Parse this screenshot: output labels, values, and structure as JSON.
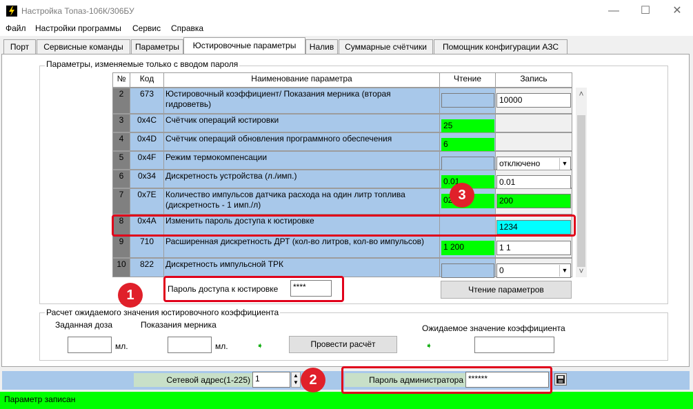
{
  "window": {
    "title": "Настройка Топаз-106К/306БУ",
    "minimize": "—",
    "maximize": "☐",
    "close": "✕"
  },
  "menu": [
    "Файл",
    "Настройки программы",
    "Сервис",
    "Справка"
  ],
  "tabs": [
    "Порт",
    "Сервисные команды",
    "Параметры",
    "Юстировочные параметры",
    "Налив",
    "Суммарные счётчики",
    "Помощник конфигурации АЗС"
  ],
  "active_tab": "Юстировочные параметры",
  "params_group": {
    "title": "Параметры, изменяемые только с вводом пароля",
    "headers": {
      "num": "№",
      "code": "Код",
      "name": "Наименование параметра",
      "read": "Чтение",
      "write": "Запись"
    },
    "rows": [
      {
        "num": "2",
        "code": "673",
        "name": "Юстировочный коэффициент/ Показания мерника (вторая гидроветвь)",
        "read": "",
        "write": "10000"
      },
      {
        "num": "3",
        "code": "0x4C",
        "name": "Счётчик операций юстировки",
        "read": "25",
        "write": ""
      },
      {
        "num": "4",
        "code": "0x4D",
        "name": "Счётчик операций обновления программного обеспечения",
        "read": "6",
        "write": ""
      },
      {
        "num": "5",
        "code": "0x4F",
        "name": "Режим термокомпенсации",
        "read": "",
        "write": "отключено"
      },
      {
        "num": "6",
        "code": "0x34",
        "name": "Дискретность устройства (л./имп.)",
        "read": "0.01",
        "write": "0.01"
      },
      {
        "num": "7",
        "code": "0x7E",
        "name": "Количество импульсов датчика расхода на один литр топлива (дискретность - 1 имп./л)",
        "read": "02",
        "write": "200"
      },
      {
        "num": "8",
        "code": "0x4A",
        "name": "Изменить пароль доступа к юстировке",
        "read": "",
        "write": "1234"
      },
      {
        "num": "9",
        "code": "710",
        "name": "Расширенная дискретность ДРТ (кол-во литров, кол-во импульсов)",
        "read": "1 200",
        "write": "1 1"
      },
      {
        "num": "10",
        "code": "822",
        "name": "Дискретность импульсной ТРК",
        "read": "",
        "write": "0"
      }
    ],
    "password_label": "Пароль доступа к юстировке",
    "password_value": "****",
    "read_button": "Чтение параметров",
    "scroll_up": "˄",
    "scroll_down": "˅"
  },
  "calc_group": {
    "title": "Расчет ожидаемого значения юстировочного коэффициента",
    "dose_label": "Заданная доза",
    "meter_label": "Показания мерника",
    "unit1": "мл.",
    "unit2": "мл.",
    "calc_button": "Провести расчёт",
    "expected_label": "Ожидаемое значение коэффициента"
  },
  "bottom_bar": {
    "net_label": "Сетевой адрес(1-225)",
    "net_value": "1",
    "admin_label": "Пароль администратора",
    "admin_value": "******"
  },
  "status": "Параметр записан",
  "annotations": [
    "1",
    "2",
    "3"
  ],
  "colors": {
    "green": "#00ff00",
    "blue_cell": "#a8c8ea",
    "cyan": "#00ffff",
    "annotation_red": "#e0001a"
  }
}
